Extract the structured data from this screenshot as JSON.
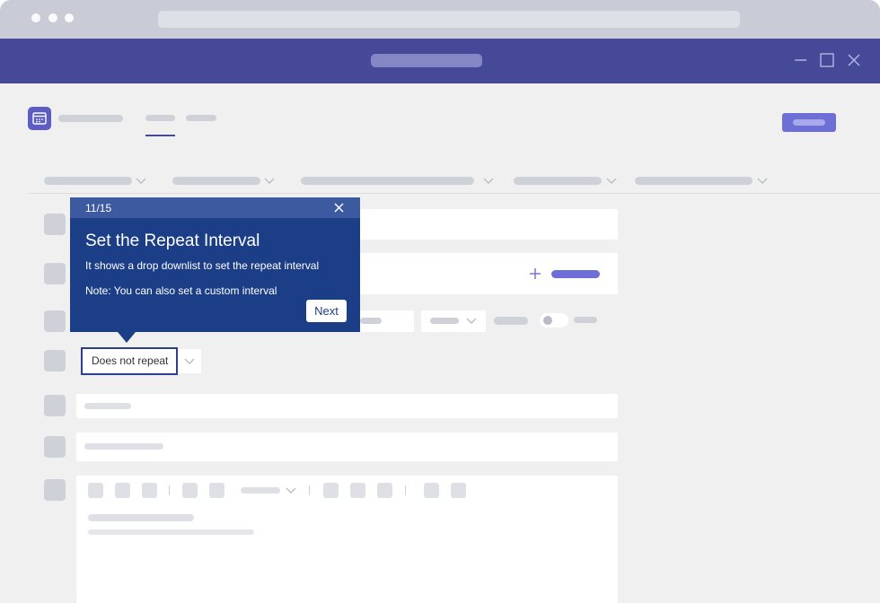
{
  "colors": {
    "titlebar": "#464898",
    "accent": "#6e6fd6",
    "coach_bg": "#1c3e87",
    "coach_header": "#3d59a0",
    "placeholder": "#cfd1d9",
    "highlight_border": "#2c3f8e"
  },
  "icons": {
    "app": "calendar-icon",
    "minimize": "minimize-icon",
    "maximize": "maximize-icon",
    "close": "close-icon",
    "add": "plus-icon",
    "dropdown": "chevron-down-icon"
  },
  "repeat": {
    "value": "Does not repeat"
  },
  "coachmark": {
    "step": "11/15",
    "title": "Set the Repeat Interval",
    "description": "It shows a drop downlist to set the repeat interval",
    "note": "Note: You can also set a custom interval",
    "next_label": "Next"
  }
}
